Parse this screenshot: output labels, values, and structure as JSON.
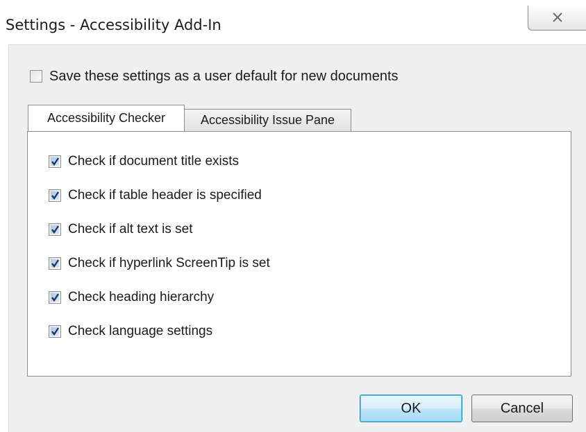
{
  "window": {
    "title": "Settings - Accessibility Add-In"
  },
  "default_setting": {
    "label": "Save these settings as a user default for new documents",
    "checked": false
  },
  "tabs": [
    {
      "label": "Accessibility Checker",
      "active": true
    },
    {
      "label": "Accessibility Issue Pane",
      "active": false
    }
  ],
  "checks": [
    {
      "label": "Check if document title exists",
      "checked": true
    },
    {
      "label": "Check if table header is specified",
      "checked": true
    },
    {
      "label": "Check if alt text is set",
      "checked": true
    },
    {
      "label": "Check if hyperlink ScreenTip is set",
      "checked": true
    },
    {
      "label": "Check heading hierarchy",
      "checked": true
    },
    {
      "label": "Check language settings",
      "checked": true
    }
  ],
  "buttons": {
    "ok_label": "OK",
    "cancel_label": "Cancel"
  },
  "colors": {
    "accent": "#3c7fb1",
    "checkbox_fill": "#a9c9ef",
    "tick": "#1e395b"
  }
}
